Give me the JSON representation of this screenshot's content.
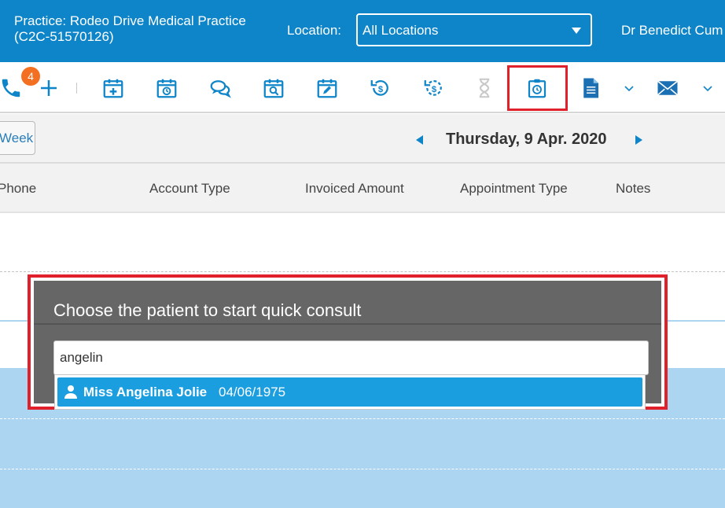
{
  "header": {
    "practice_line1": "Practice: Rodeo Drive Medical Practice",
    "practice_line2": "(C2C-51570126)",
    "location_label": "Location:",
    "location_value": "All Locations",
    "doctor": "Dr Benedict Cum"
  },
  "toolbar": {
    "badge_count": "4",
    "icons": [
      "phone-icon",
      "add-icon",
      "calendar-add-icon",
      "calendar-history-icon",
      "chat-icon",
      "calendar-search-icon",
      "calendar-edit-icon",
      "refund-icon",
      "payment-icon",
      "hourglass-icon",
      "quick-consult-icon",
      "document-icon",
      "envelope-icon"
    ]
  },
  "datebar": {
    "week_label": "Week",
    "date": "Thursday, 9 Apr. 2020"
  },
  "columns": [
    "Phone",
    "Account Type",
    "Invoiced Amount",
    "Appointment Type",
    "Notes"
  ],
  "dialog": {
    "title": "Choose the patient to start quick consult",
    "search_value": "angelin",
    "result_name": "Miss Angelina Jolie",
    "result_dob": "04/06/1975"
  },
  "colors": {
    "brand_blue": "#0e85c8",
    "badge_orange": "#f36f21",
    "highlight_red": "#e0202a",
    "selection_blue": "#1b9ee0"
  }
}
